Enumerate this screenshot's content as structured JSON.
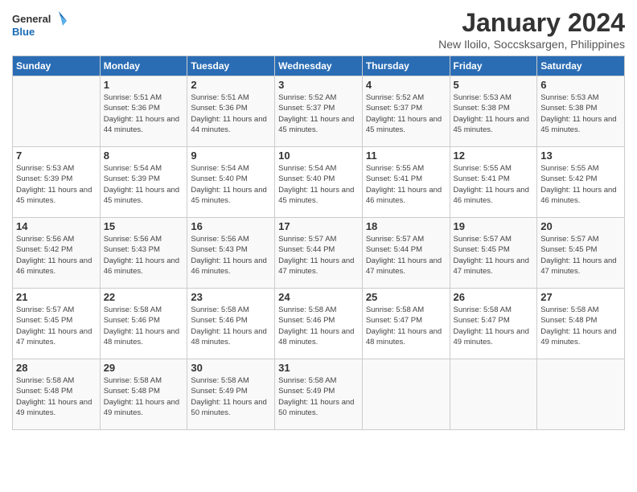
{
  "logo": {
    "line1": "General",
    "line2": "Blue"
  },
  "title": "January 2024",
  "subtitle": "New Iloilo, Soccsksargen, Philippines",
  "headers": [
    "Sunday",
    "Monday",
    "Tuesday",
    "Wednesday",
    "Thursday",
    "Friday",
    "Saturday"
  ],
  "weeks": [
    [
      {
        "day": "",
        "sunrise": "",
        "sunset": "",
        "daylight": ""
      },
      {
        "day": "1",
        "sunrise": "Sunrise: 5:51 AM",
        "sunset": "Sunset: 5:36 PM",
        "daylight": "Daylight: 11 hours and 44 minutes."
      },
      {
        "day": "2",
        "sunrise": "Sunrise: 5:51 AM",
        "sunset": "Sunset: 5:36 PM",
        "daylight": "Daylight: 11 hours and 44 minutes."
      },
      {
        "day": "3",
        "sunrise": "Sunrise: 5:52 AM",
        "sunset": "Sunset: 5:37 PM",
        "daylight": "Daylight: 11 hours and 45 minutes."
      },
      {
        "day": "4",
        "sunrise": "Sunrise: 5:52 AM",
        "sunset": "Sunset: 5:37 PM",
        "daylight": "Daylight: 11 hours and 45 minutes."
      },
      {
        "day": "5",
        "sunrise": "Sunrise: 5:53 AM",
        "sunset": "Sunset: 5:38 PM",
        "daylight": "Daylight: 11 hours and 45 minutes."
      },
      {
        "day": "6",
        "sunrise": "Sunrise: 5:53 AM",
        "sunset": "Sunset: 5:38 PM",
        "daylight": "Daylight: 11 hours and 45 minutes."
      }
    ],
    [
      {
        "day": "7",
        "sunrise": "Sunrise: 5:53 AM",
        "sunset": "Sunset: 5:39 PM",
        "daylight": "Daylight: 11 hours and 45 minutes."
      },
      {
        "day": "8",
        "sunrise": "Sunrise: 5:54 AM",
        "sunset": "Sunset: 5:39 PM",
        "daylight": "Daylight: 11 hours and 45 minutes."
      },
      {
        "day": "9",
        "sunrise": "Sunrise: 5:54 AM",
        "sunset": "Sunset: 5:40 PM",
        "daylight": "Daylight: 11 hours and 45 minutes."
      },
      {
        "day": "10",
        "sunrise": "Sunrise: 5:54 AM",
        "sunset": "Sunset: 5:40 PM",
        "daylight": "Daylight: 11 hours and 45 minutes."
      },
      {
        "day": "11",
        "sunrise": "Sunrise: 5:55 AM",
        "sunset": "Sunset: 5:41 PM",
        "daylight": "Daylight: 11 hours and 46 minutes."
      },
      {
        "day": "12",
        "sunrise": "Sunrise: 5:55 AM",
        "sunset": "Sunset: 5:41 PM",
        "daylight": "Daylight: 11 hours and 46 minutes."
      },
      {
        "day": "13",
        "sunrise": "Sunrise: 5:55 AM",
        "sunset": "Sunset: 5:42 PM",
        "daylight": "Daylight: 11 hours and 46 minutes."
      }
    ],
    [
      {
        "day": "14",
        "sunrise": "Sunrise: 5:56 AM",
        "sunset": "Sunset: 5:42 PM",
        "daylight": "Daylight: 11 hours and 46 minutes."
      },
      {
        "day": "15",
        "sunrise": "Sunrise: 5:56 AM",
        "sunset": "Sunset: 5:43 PM",
        "daylight": "Daylight: 11 hours and 46 minutes."
      },
      {
        "day": "16",
        "sunrise": "Sunrise: 5:56 AM",
        "sunset": "Sunset: 5:43 PM",
        "daylight": "Daylight: 11 hours and 46 minutes."
      },
      {
        "day": "17",
        "sunrise": "Sunrise: 5:57 AM",
        "sunset": "Sunset: 5:44 PM",
        "daylight": "Daylight: 11 hours and 47 minutes."
      },
      {
        "day": "18",
        "sunrise": "Sunrise: 5:57 AM",
        "sunset": "Sunset: 5:44 PM",
        "daylight": "Daylight: 11 hours and 47 minutes."
      },
      {
        "day": "19",
        "sunrise": "Sunrise: 5:57 AM",
        "sunset": "Sunset: 5:45 PM",
        "daylight": "Daylight: 11 hours and 47 minutes."
      },
      {
        "day": "20",
        "sunrise": "Sunrise: 5:57 AM",
        "sunset": "Sunset: 5:45 PM",
        "daylight": "Daylight: 11 hours and 47 minutes."
      }
    ],
    [
      {
        "day": "21",
        "sunrise": "Sunrise: 5:57 AM",
        "sunset": "Sunset: 5:45 PM",
        "daylight": "Daylight: 11 hours and 47 minutes."
      },
      {
        "day": "22",
        "sunrise": "Sunrise: 5:58 AM",
        "sunset": "Sunset: 5:46 PM",
        "daylight": "Daylight: 11 hours and 48 minutes."
      },
      {
        "day": "23",
        "sunrise": "Sunrise: 5:58 AM",
        "sunset": "Sunset: 5:46 PM",
        "daylight": "Daylight: 11 hours and 48 minutes."
      },
      {
        "day": "24",
        "sunrise": "Sunrise: 5:58 AM",
        "sunset": "Sunset: 5:46 PM",
        "daylight": "Daylight: 11 hours and 48 minutes."
      },
      {
        "day": "25",
        "sunrise": "Sunrise: 5:58 AM",
        "sunset": "Sunset: 5:47 PM",
        "daylight": "Daylight: 11 hours and 48 minutes."
      },
      {
        "day": "26",
        "sunrise": "Sunrise: 5:58 AM",
        "sunset": "Sunset: 5:47 PM",
        "daylight": "Daylight: 11 hours and 49 minutes."
      },
      {
        "day": "27",
        "sunrise": "Sunrise: 5:58 AM",
        "sunset": "Sunset: 5:48 PM",
        "daylight": "Daylight: 11 hours and 49 minutes."
      }
    ],
    [
      {
        "day": "28",
        "sunrise": "Sunrise: 5:58 AM",
        "sunset": "Sunset: 5:48 PM",
        "daylight": "Daylight: 11 hours and 49 minutes."
      },
      {
        "day": "29",
        "sunrise": "Sunrise: 5:58 AM",
        "sunset": "Sunset: 5:48 PM",
        "daylight": "Daylight: 11 hours and 49 minutes."
      },
      {
        "day": "30",
        "sunrise": "Sunrise: 5:58 AM",
        "sunset": "Sunset: 5:49 PM",
        "daylight": "Daylight: 11 hours and 50 minutes."
      },
      {
        "day": "31",
        "sunrise": "Sunrise: 5:58 AM",
        "sunset": "Sunset: 5:49 PM",
        "daylight": "Daylight: 11 hours and 50 minutes."
      },
      {
        "day": "",
        "sunrise": "",
        "sunset": "",
        "daylight": ""
      },
      {
        "day": "",
        "sunrise": "",
        "sunset": "",
        "daylight": ""
      },
      {
        "day": "",
        "sunrise": "",
        "sunset": "",
        "daylight": ""
      }
    ]
  ]
}
